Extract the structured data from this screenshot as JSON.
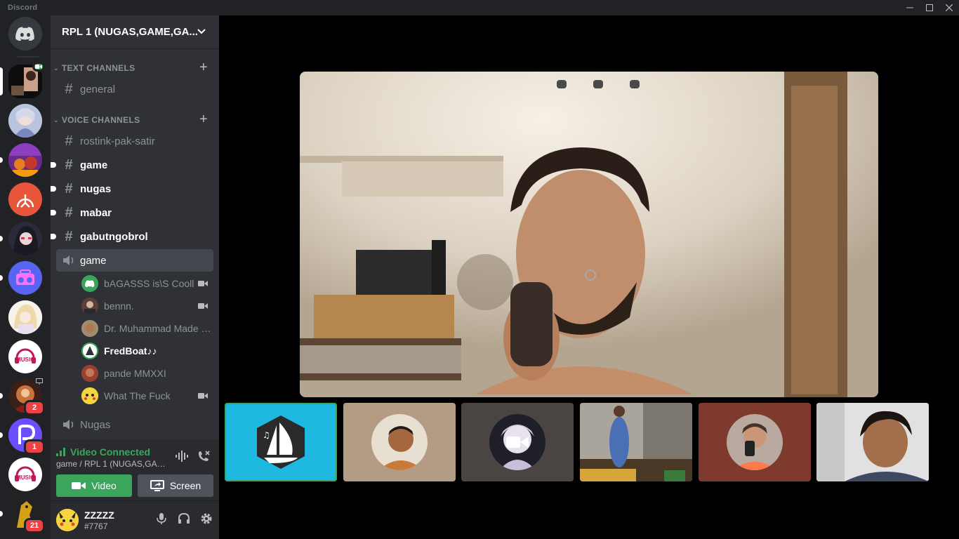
{
  "window": {
    "brand": "Discord",
    "minimize_icon": "minimize-icon",
    "maximize_icon": "maximize-icon",
    "close_icon": "close-icon"
  },
  "rail": {
    "home_icon": "discord-logo-icon",
    "servers": [
      {
        "name": "server-1",
        "badge": "",
        "status": "video"
      },
      {
        "name": "server-2",
        "badge": ""
      },
      {
        "name": "server-3",
        "badge": ""
      },
      {
        "name": "server-4",
        "badge": ""
      },
      {
        "name": "server-5",
        "badge": ""
      },
      {
        "name": "server-6",
        "badge": ""
      },
      {
        "name": "server-7",
        "badge": ""
      },
      {
        "name": "server-8",
        "badge": ""
      },
      {
        "name": "server-9",
        "badge": "2"
      },
      {
        "name": "server-10",
        "badge": "1"
      },
      {
        "name": "server-11",
        "badge": ""
      },
      {
        "name": "server-12",
        "badge": "21"
      }
    ],
    "music_logo_text": "MUSIC"
  },
  "guild": {
    "name": "RPL 1 (NUGAS,GAME,GA..."
  },
  "categories": {
    "text": "TEXT CHANNELS",
    "voice": "VOICE CHANNELS"
  },
  "text_channels": [
    "general"
  ],
  "voice_section_channels": [
    {
      "label": "rostink-pak-satir",
      "unread": false
    },
    {
      "label": "game",
      "unread": true
    },
    {
      "label": "nugas",
      "unread": true
    },
    {
      "label": "mabar",
      "unread": true
    },
    {
      "label": "gabutngobrol",
      "unread": true
    }
  ],
  "voice_channel": {
    "label": "game",
    "users": [
      {
        "name": "bAGASSS is\\S Cooll",
        "camera": true
      },
      {
        "name": "bennn.",
        "camera": true
      },
      {
        "name": "Dr. Muhammad Made m...",
        "camera": false
      },
      {
        "name": "FredBoat♪♪",
        "camera": false
      },
      {
        "name": "pande MMXXI",
        "camera": false
      },
      {
        "name": "What The Fuck",
        "camera": true
      }
    ]
  },
  "voice_channel_2": {
    "label": "Nugas"
  },
  "voice_status": {
    "title": "Video Connected",
    "subtitle": "game / RPL 1 (NUGAS,GAM...",
    "video_button": "Video",
    "screen_button": "Screen"
  },
  "user": {
    "name": "ZZZZZ",
    "tag": "#7767"
  },
  "colors": {
    "accent_green": "#3ba55c",
    "fredboat_tile": "#1fb8e0",
    "tile_2": "#b49b83",
    "tile_3": "#4a4443",
    "tile_5": "#7d3a2d"
  }
}
